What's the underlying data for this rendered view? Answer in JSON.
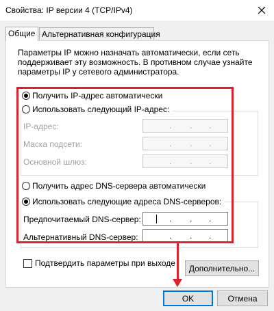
{
  "window": {
    "title": "Свойства: IP версии 4 (TCP/IPv4)",
    "close_icon": "close-icon"
  },
  "tabs": [
    {
      "label": "Общие",
      "active": true
    },
    {
      "label": "Альтернативная конфигурация",
      "active": false
    }
  ],
  "description": [
    "Параметры IP можно назначать автоматически, если сеть",
    "поддерживает эту возможность. В противном случае узнайте",
    "параметры IP у сетевого администратора."
  ],
  "ip_section": {
    "auto_label": "Получить IP-адрес автоматически",
    "auto_checked": true,
    "manual_label": "Использовать следующий IP-адрес:",
    "manual_checked": false,
    "fields": [
      {
        "label": "IP-адрес:",
        "value": ". . ."
      },
      {
        "label": "Маска подсети:",
        "value": ". . ."
      },
      {
        "label": "Основной шлюз:",
        "value": ". . ."
      }
    ]
  },
  "dns_section": {
    "auto_label": "Получить адрес DNS-сервера автоматически",
    "auto_checked": false,
    "manual_label": "Использовать следующие адреса DNS-серверов:",
    "manual_checked": true,
    "fields": [
      {
        "label": "Предпочитаемый DNS-сервер:",
        "value": ". . ."
      },
      {
        "label": "Альтернативный DNS-сервер:",
        "value": ". . ."
      }
    ]
  },
  "validate": {
    "label": "Подтвердить параметры при выходе",
    "checked": false
  },
  "buttons": {
    "advanced": "Дополнительно...",
    "ok": "OK",
    "cancel": "Отмена"
  },
  "colors": {
    "highlight": "#e21f2d",
    "default_button_border": "#0078d7"
  }
}
